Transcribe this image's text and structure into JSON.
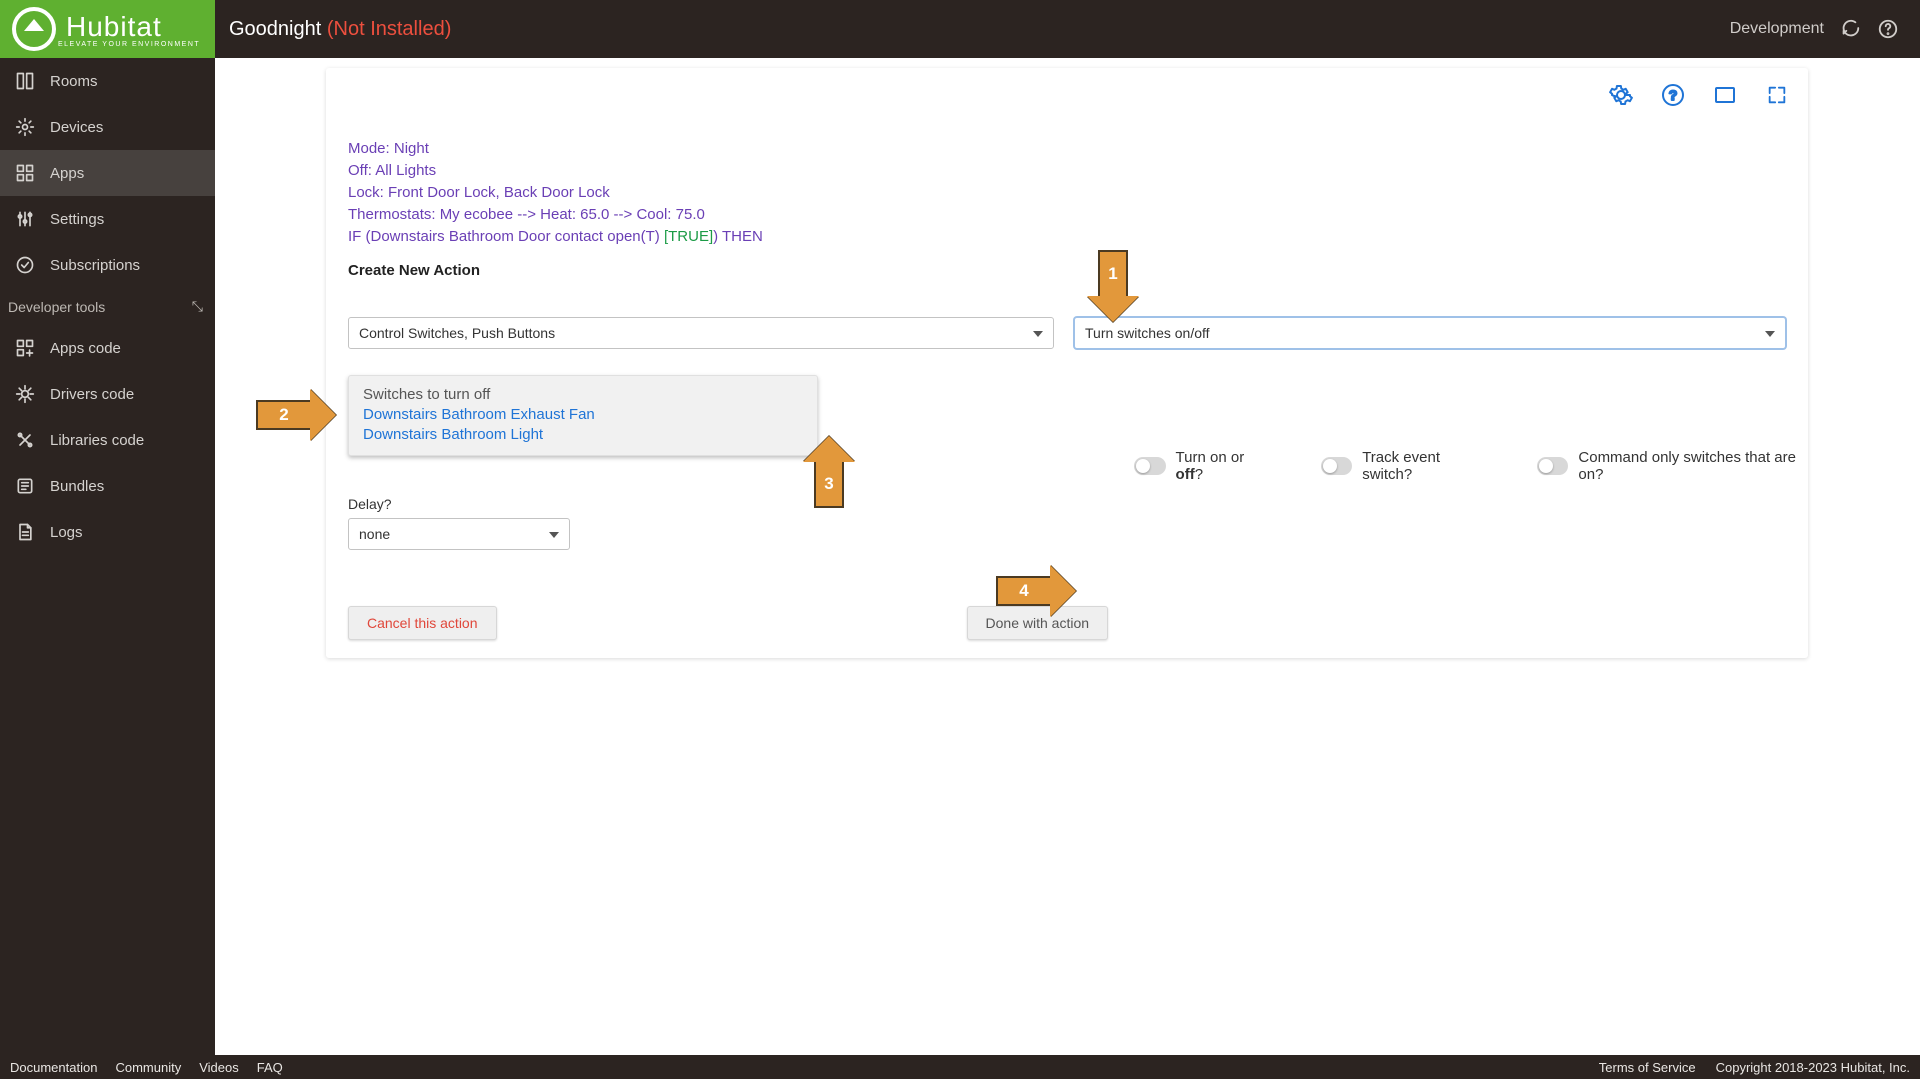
{
  "brand": {
    "name": "Hubitat",
    "tagline": "ELEVATE YOUR ENVIRONMENT"
  },
  "header": {
    "title": "Goodnight",
    "status": "(Not Installed)",
    "env_label": "Development"
  },
  "sidebar": {
    "items": [
      {
        "label": "Rooms"
      },
      {
        "label": "Devices"
      },
      {
        "label": "Apps"
      },
      {
        "label": "Settings"
      },
      {
        "label": "Subscriptions"
      }
    ],
    "dev_header": "Developer tools",
    "dev_items": [
      {
        "label": "Apps code"
      },
      {
        "label": "Drivers code"
      },
      {
        "label": "Libraries code"
      },
      {
        "label": "Bundles"
      },
      {
        "label": "Logs"
      }
    ]
  },
  "rule": {
    "line1": "Mode: Night",
    "line2": "Off: All Lights",
    "line3": "Lock: Front Door Lock, Back Door Lock",
    "line4": "Thermostats: My ecobee --> Heat: 65.0 --> Cool: 75.0",
    "line5_prefix": "IF (Downstairs Bathroom Door contact open(T) ",
    "line5_true": "[TRUE]",
    "line5_suffix": ") THEN"
  },
  "form": {
    "create_new": "Create New Action",
    "action_category": "Control Switches, Push Buttons",
    "action_type": "Turn switches on/off",
    "switches_label": "Switches to turn off",
    "switches": [
      "Downstairs Bathroom Exhaust Fan",
      "Downstairs Bathroom Light"
    ],
    "toggle1_prefix": "Turn on or ",
    "toggle1_bold": "off",
    "toggle1_suffix": "?",
    "toggle2": "Track event switch?",
    "toggle3": "Command only switches that are on?",
    "delay_label": "Delay?",
    "delay_value": "none",
    "cancel": "Cancel this action",
    "done": "Done with action"
  },
  "footer": {
    "links": [
      "Documentation",
      "Community",
      "Videos",
      "FAQ"
    ],
    "tos": "Terms of Service",
    "copyright": "Copyright 2018-2023 Hubitat, Inc."
  },
  "annotations": {
    "a1": "1",
    "a2": "2",
    "a3": "3",
    "a4": "4"
  }
}
